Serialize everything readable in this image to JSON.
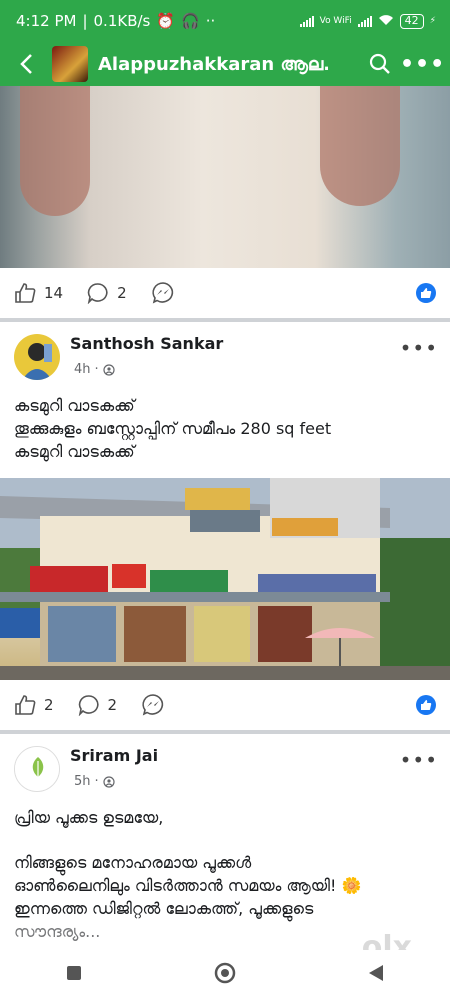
{
  "status": {
    "time": "4:12 PM",
    "speed": "0.1KB/s",
    "battery": "42",
    "wifi_label": "Vo WiFi"
  },
  "appbar": {
    "title": "Alappuzhakkaran ആല..."
  },
  "post1": {
    "likes": "14",
    "comments": "2"
  },
  "post2": {
    "author": "Santhosh Sankar",
    "time": "4h",
    "text_line1": "കടമുറി വാടകക്ക്",
    "text_line2": "തൂക്കുകുളം ബസ്റ്റോപ്പിന് സമീപം 280 sq feet",
    "text_line3": "കടമുറി വാടകക്ക്",
    "likes": "2",
    "comments": "2"
  },
  "post3": {
    "author": "Sriram Jai",
    "time": "5h",
    "text_line1": "പ്രിയ പൂക്കട ഉടമയേ,",
    "text_line2": "നിങ്ങളുടെ മനോഹരമായ പൂക്കൾ",
    "text_line3": "ഓൺലൈനിലും വിടർത്താൻ സമയം ആയി!",
    "text_line4": "ഇന്നത്തെ ഡിജിറ്റൽ ലോകത്ത്, പൂക്കളുടെ",
    "text_line5": "സൗന്ദര്യം..."
  },
  "watermark": "olx",
  "colors": {
    "brand": "#2ea84a",
    "like_blue": "#1877f2"
  }
}
